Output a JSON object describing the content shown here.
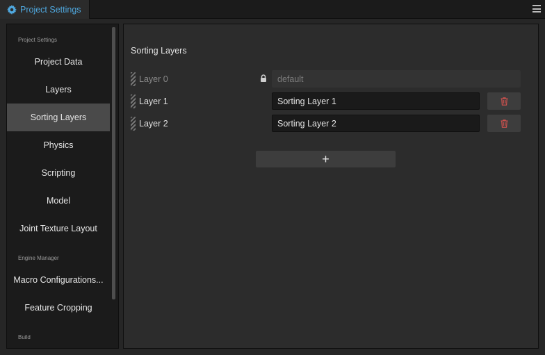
{
  "window": {
    "tab_title": "Project Settings",
    "tab_icon": "gear-icon",
    "menu_icon": "hamburger-menu-icon",
    "accent_color": "#4fa8df"
  },
  "sidebar": {
    "groups": [
      {
        "label": "Project Settings"
      },
      {
        "label": "Engine Manager"
      },
      {
        "label": "Build"
      }
    ],
    "items": [
      {
        "label": "Project Data"
      },
      {
        "label": "Layers"
      },
      {
        "label": "Sorting Layers",
        "active": true
      },
      {
        "label": "Physics"
      },
      {
        "label": "Scripting"
      },
      {
        "label": "Model"
      },
      {
        "label": "Joint Texture Layout"
      },
      {
        "label": "Macro Configurations..."
      },
      {
        "label": "Feature Cropping"
      }
    ]
  },
  "main": {
    "title": "Sorting Layers",
    "layers": [
      {
        "name": "Layer 0",
        "value": "default",
        "locked": true
      },
      {
        "name": "Layer 1",
        "value": "Sorting Layer 1",
        "locked": false
      },
      {
        "name": "Layer 2",
        "value": "Sorting Layer 2",
        "locked": false
      }
    ],
    "add_button_label": "+",
    "delete_icon": "trash-icon",
    "delete_color": "#d9534f"
  }
}
